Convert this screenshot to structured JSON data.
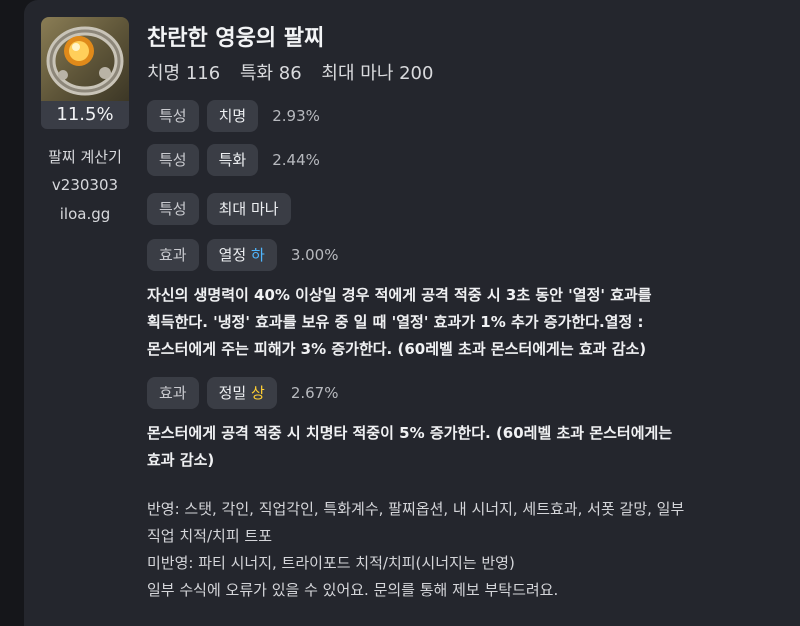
{
  "item": {
    "title": "찬란한 영웅의 팔찌",
    "stats": [
      "치명 116",
      "특화 86",
      "최대 마나 200"
    ],
    "percent": "11.5%"
  },
  "sidebar": {
    "name": "팔찌 계산기",
    "version": "v230303",
    "site": "iloa.gg"
  },
  "options": [
    {
      "type": "특성",
      "name": "치명",
      "grade": "",
      "value": "2.93%"
    },
    {
      "type": "특성",
      "name": "특화",
      "grade": "",
      "value": "2.44%"
    },
    {
      "type": "특성",
      "name": "최대 마나",
      "grade": "",
      "value": ""
    },
    {
      "type": "효과",
      "name": "열정",
      "grade": "하",
      "value": "3.00%",
      "desc": [
        "자신의 생명력이 40% 이상일 경우 적에게 공격 적중 시 3초 동안 '열정' 효과를",
        "획득한다. '냉정' 효과를 보유 중 일 때 '열정' 효과가 1% 추가 증가한다.열정 :",
        "몬스터에게 주는 피해가 3% 증가한다. (60레벨 초과 몬스터에게는 효과 감소)"
      ]
    },
    {
      "type": "효과",
      "name": "정밀",
      "grade": "상",
      "value": "2.67%",
      "desc": [
        "몬스터에게 공격 적중 시 치명타 적중이 5% 증가한다. (60레벨 초과 몬스터에게는",
        "효과 감소)"
      ]
    }
  ],
  "footer": [
    "반영: 스탯, 각인, 직업각인, 특화계수, 팔찌옵션, 내 시너지, 세트효과, 서폿 갈망, 일부",
    "직업 치적/치피 트포",
    "미반영: 파티 시너지, 트라이포드 치적/치피(시너지는 반영)",
    "일부 수식에 오류가 있을 수 있어요. 문의를 통해 제보 부탁드려요."
  ],
  "colors": {
    "grade_low": "#4fb6ff",
    "grade_high": "#ffcf33",
    "panel": "#24262d"
  }
}
